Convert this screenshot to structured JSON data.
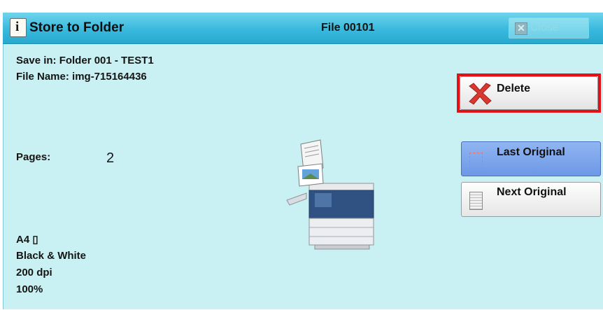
{
  "title": {
    "icon": "info-icon",
    "text": "Store to Folder",
    "file_no": "File 00101"
  },
  "close_button": {
    "label": "Close",
    "icon": "close-icon"
  },
  "info": {
    "save_in": "Save in: Folder 001 - TEST1",
    "file_name": "File Name: img-715164436",
    "pages_label": "Pages:",
    "pages_value": "2",
    "paper": "A4 ▯",
    "color_mode": "Black & White",
    "resolution": "200 dpi",
    "scale": "100%"
  },
  "buttons": {
    "delete": "Delete",
    "last_original": "Last Original",
    "next_original": "Next Original"
  },
  "colors": {
    "accent_blue": "#2aa9cf",
    "panel": "#c9f0f2",
    "highlight_red": "#e41017",
    "selected_button": "#7ea6ec"
  }
}
